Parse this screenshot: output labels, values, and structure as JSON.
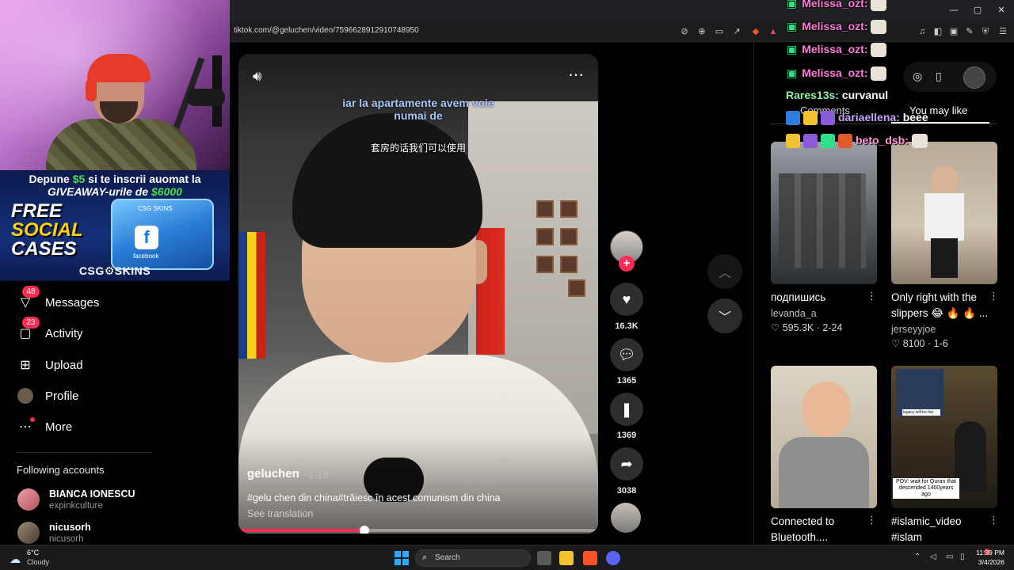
{
  "browser": {
    "url": "tiktok.com/@geluchen/video/7596628912910748950",
    "window_buttons": [
      "—",
      "▢",
      "✕"
    ]
  },
  "stream": {
    "promo_line1_pre": "Depune ",
    "promo_line1_amount": "$5",
    "promo_line1_post": " si te inscrii auomat la",
    "promo_line2_pre": "GIVEAWAY-urile de ",
    "promo_line2_amount": "$6000",
    "promo_free": "FREE",
    "promo_social": "SOCIAL",
    "promo_cases": "CASES",
    "promo_case_label": "CSG SKINS",
    "promo_facebook": "facebook",
    "promo_brand": "CSG⚙SKINS"
  },
  "sidebar": {
    "items": [
      {
        "label": "Messages",
        "badge": "48",
        "icon": "send-icon"
      },
      {
        "label": "Activity",
        "badge": "23",
        "icon": "inbox-icon"
      },
      {
        "label": "Upload",
        "icon": "plus-square-icon"
      },
      {
        "label": "Profile",
        "icon": "profile-avatar"
      },
      {
        "label": "More",
        "icon": "more-dots-icon"
      }
    ],
    "following_title": "Following accounts",
    "following": [
      {
        "name": "BIANCA IONESCU",
        "username": "expinkculture"
      },
      {
        "name": "nicusorh",
        "username": "nicusorh"
      }
    ]
  },
  "video": {
    "caption_ro_line1": "iar la apartamente avem voie",
    "caption_ro_line2": "numai de",
    "caption_zh": "套房的话我们可以使用",
    "author": "geluchen",
    "date": "· 1-18",
    "description": "#gelu chen din china#trăiesc în acest comunism din china",
    "see_translation": "See translation",
    "progress": 0.35
  },
  "actions": {
    "likes": "16.3K",
    "comments": "1365",
    "saves": "1369",
    "shares": "3038",
    "follow": "+"
  },
  "right_panel": {
    "tab_comments": "Comments",
    "tab_you_may_like": "You may like",
    "cards": [
      {
        "title": "подпишись",
        "user": "levanda_a",
        "likes": "595.3K",
        "date": "2-24"
      },
      {
        "title": "Only right with the slippers 😂 🔥 🔥 ...",
        "user": "jerseyyjoe",
        "likes": "8100",
        "date": "1-6"
      },
      {
        "title": "Connected to Bluetooth....",
        "user": "",
        "likes": "",
        "date": ""
      },
      {
        "title": "#islamic_video #islam",
        "user": "",
        "likes": "",
        "date": "",
        "overlay_top": "legacy will be her",
        "overlay_bottom": "POV: wait for Quran that descended 1400years ago"
      }
    ]
  },
  "chat": [
    {
      "user": "Melissa_ozt:",
      "msg": ""
    },
    {
      "user": "Melissa_ozt:",
      "msg": ""
    },
    {
      "user": "Melissa_ozt:",
      "msg": ""
    },
    {
      "user": "Melissa_ozt:",
      "msg": ""
    },
    {
      "user": "Rares13s:",
      "msg": "curvanul"
    },
    {
      "user": "dariaellena:",
      "msg": "beee"
    },
    {
      "user": "beto_dsb:",
      "msg": ""
    }
  ],
  "taskbar": {
    "temp": "6°C",
    "condition": "Cloudy",
    "search_placeholder": "Search",
    "time": "11:39 PM",
    "date": "3/4/2026"
  },
  "colors": {
    "accent": "#fe2c55",
    "background": "#000000",
    "chat_gift": "#2fe08a"
  }
}
